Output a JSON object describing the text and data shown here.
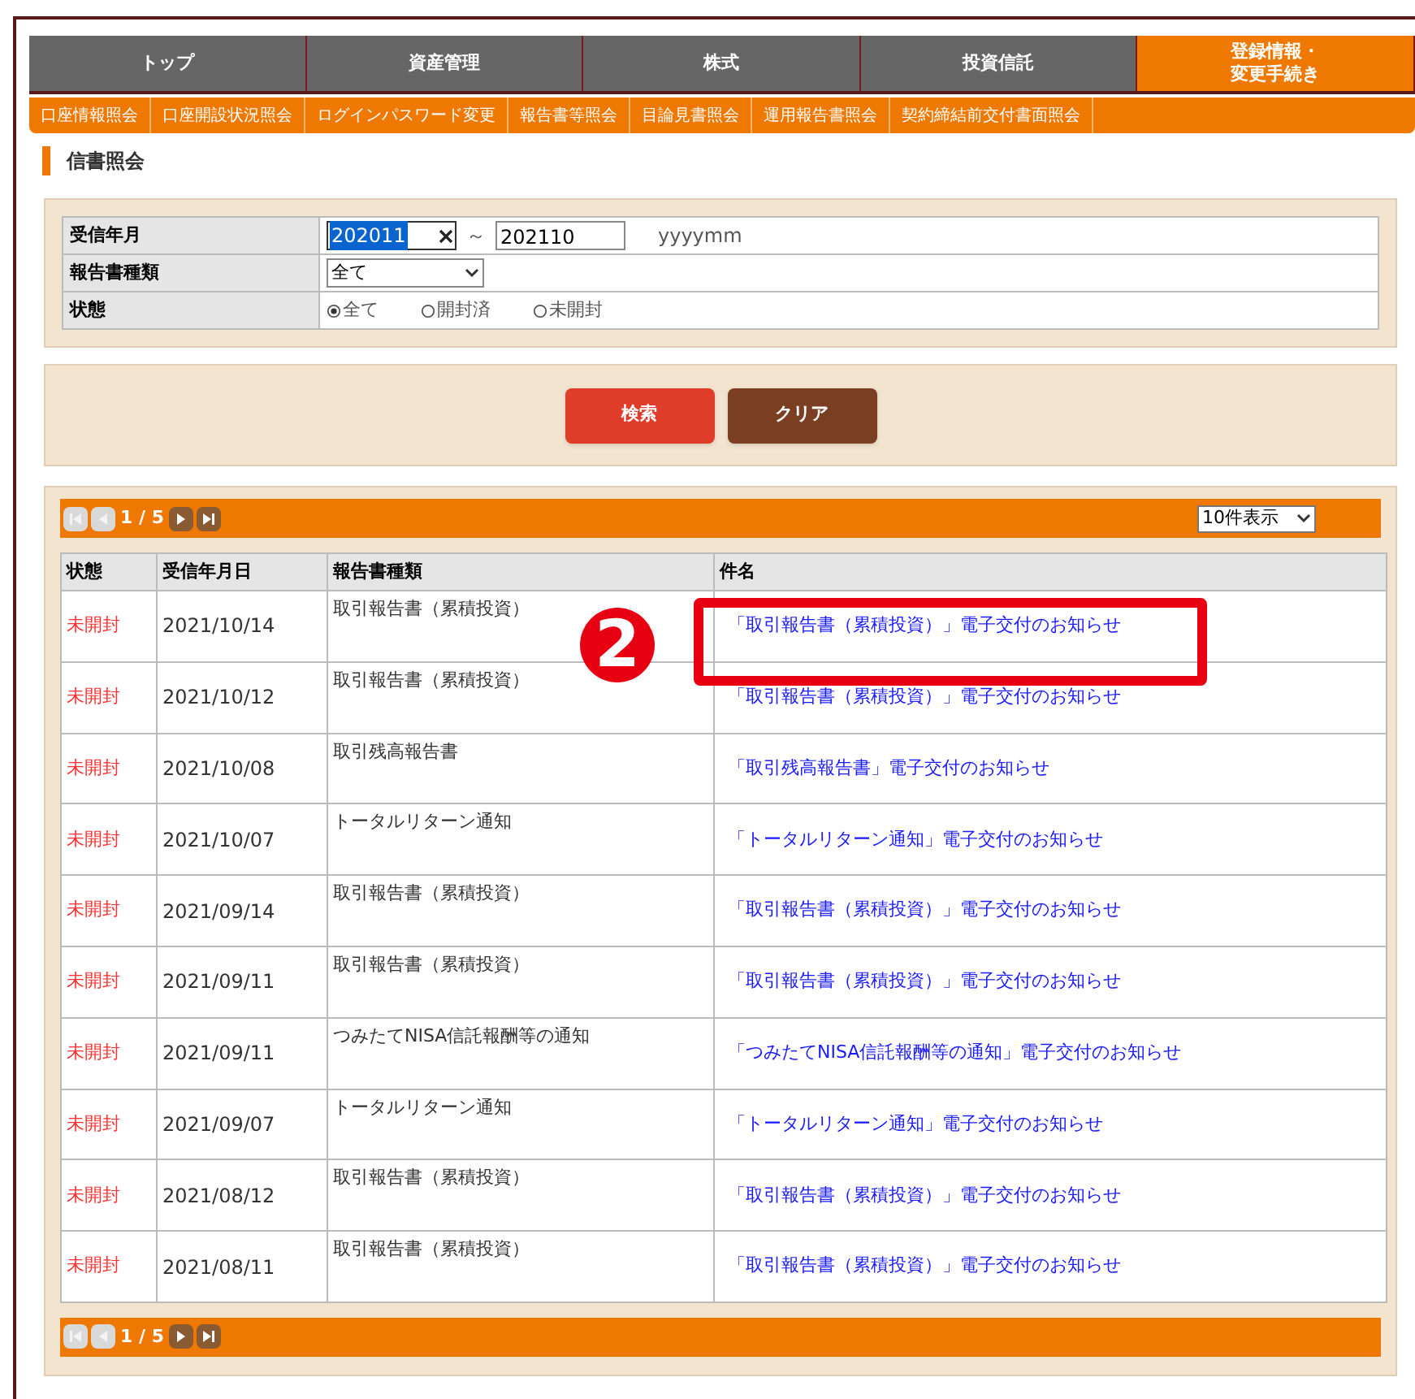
{
  "nav_tabs": [
    {
      "label": "トップ",
      "selected": false
    },
    {
      "label": "資産管理",
      "selected": false
    },
    {
      "label": "株式",
      "selected": false
    },
    {
      "label": "投資信託",
      "selected": false
    },
    {
      "label": "登録情報・変更手続き",
      "selected": true
    }
  ],
  "sub_nav": [
    "口座情報照会",
    "口座開設状況照会",
    "ログインパスワード変更",
    "報告書等照会",
    "目論見書照会",
    "運用報告書照会",
    "契約締結前交付書面照会"
  ],
  "page_title": "信書照会",
  "search_form": {
    "received_month": {
      "label": "受信年月",
      "from": "202011",
      "separator": "～",
      "to": "202110",
      "format_hint": "yyyymm"
    },
    "report_type": {
      "label": "報告書種類",
      "value": "全て"
    },
    "status": {
      "label": "状態",
      "options": [
        {
          "label": "全て",
          "selected": true
        },
        {
          "label": "開封済",
          "selected": false
        },
        {
          "label": "未開封",
          "selected": false
        }
      ]
    }
  },
  "buttons": {
    "search": "検索",
    "clear": "クリア"
  },
  "pagination_top": {
    "page": "1 / 5",
    "first_disabled": true,
    "prev_disabled": true,
    "next_disabled": false,
    "last_disabled": false
  },
  "pagination_bottom": {
    "page": "1 / 5",
    "first_disabled": true,
    "prev_disabled": true,
    "next_disabled": false,
    "last_disabled": false
  },
  "per_page": "10件表示",
  "table": {
    "columns": [
      "状態",
      "受信年月日",
      "報告書種類",
      "件名"
    ],
    "rows": [
      {
        "status": "未開封",
        "unread": true,
        "date": "2021/10/14",
        "type": "取引報告書（累積投資）",
        "subject": "「取引報告書（累積投資）」電子交付のお知らせ",
        "highlighted": true
      },
      {
        "status": "未開封",
        "unread": true,
        "date": "2021/10/12",
        "type": "取引報告書（累積投資）",
        "subject": "「取引報告書（累積投資）」電子交付のお知らせ",
        "highlighted": false
      },
      {
        "status": "未開封",
        "unread": true,
        "date": "2021/10/08",
        "type": "取引残高報告書",
        "subject": "「取引残高報告書」電子交付のお知らせ",
        "highlighted": false
      },
      {
        "status": "未開封",
        "unread": true,
        "date": "2021/10/07",
        "type": "トータルリターン通知",
        "subject": "「トータルリターン通知」電子交付のお知らせ",
        "highlighted": false
      },
      {
        "status": "未開封",
        "unread": true,
        "date": "2021/09/14",
        "type": "取引報告書（累積投資）",
        "subject": "「取引報告書（累積投資）」電子交付のお知らせ",
        "highlighted": false
      },
      {
        "status": "未開封",
        "unread": true,
        "date": "2021/09/11",
        "type": "取引報告書（累積投資）",
        "subject": "「取引報告書（累積投資）」電子交付のお知らせ",
        "highlighted": false
      },
      {
        "status": "未開封",
        "unread": true,
        "date": "2021/09/11",
        "type": "つみたてNISA信託報酬等の通知",
        "subject": "「つみたてNISA信託報酬等の通知」電子交付のお知らせ",
        "highlighted": false
      },
      {
        "status": "未開封",
        "unread": true,
        "date": "2021/09/07",
        "type": "トータルリターン通知",
        "subject": "「トータルリターン通知」電子交付のお知らせ",
        "highlighted": false
      },
      {
        "status": "未開封",
        "unread": true,
        "date": "2021/08/12",
        "type": "取引報告書（累積投資）",
        "subject": "「取引報告書（累積投資）」電子交付のお知らせ",
        "highlighted": false
      },
      {
        "status": "未開封",
        "unread": true,
        "date": "2021/08/11",
        "type": "取引報告書（累積投資）",
        "subject": "「取引報告書（累積投資）」電子交付のお知らせ",
        "highlighted": false
      }
    ]
  },
  "callout": "2"
}
